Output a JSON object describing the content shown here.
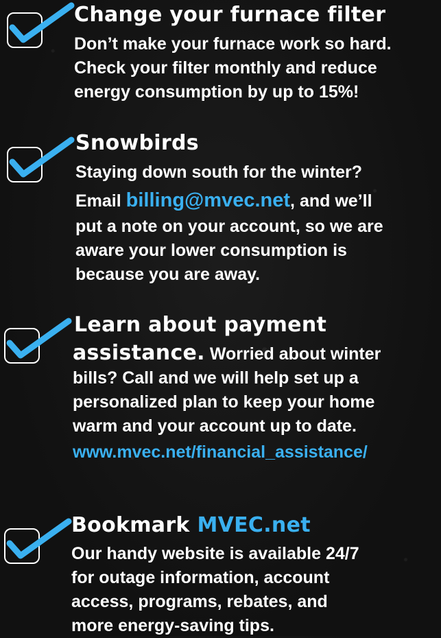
{
  "items": [
    {
      "title": "Change your furnace filter",
      "lines": [
        "Don’t make your furnace work so hard.",
        "Check your filter monthly and reduce",
        "energy consumption by up to 15%!"
      ]
    },
    {
      "title": "Snowbirds",
      "line1": "Staying down south for the winter?",
      "email_prefix": "Email ",
      "email": "billing@mvec.net",
      "email_suffix": ", and we’ll",
      "lines": [
        "put a note on your account, so we are",
        "aware your lower consumption is",
        "because you are away."
      ]
    },
    {
      "title_line1": "Learn about payment",
      "title_line2": "assistance.",
      "inline_text": " Worried about winter",
      "lines": [
        "bills? Call and we will help set up a",
        "personalized plan to keep your home",
        "warm and your account up to date."
      ],
      "link": "www.mvec.net/financial_assistance/"
    },
    {
      "title_prefix": "Bookmark ",
      "title_link": "MVEC.net",
      "lines": [
        "Our handy website is available 24/7",
        "for outage information, account",
        "access, programs, rebates, and",
        "more energy-saving tips."
      ]
    }
  ],
  "colors": {
    "accent": "#3ab0f0",
    "text": "#ffffff",
    "background": "#141414"
  },
  "icons": [
    "checkbox-checked-icon"
  ]
}
